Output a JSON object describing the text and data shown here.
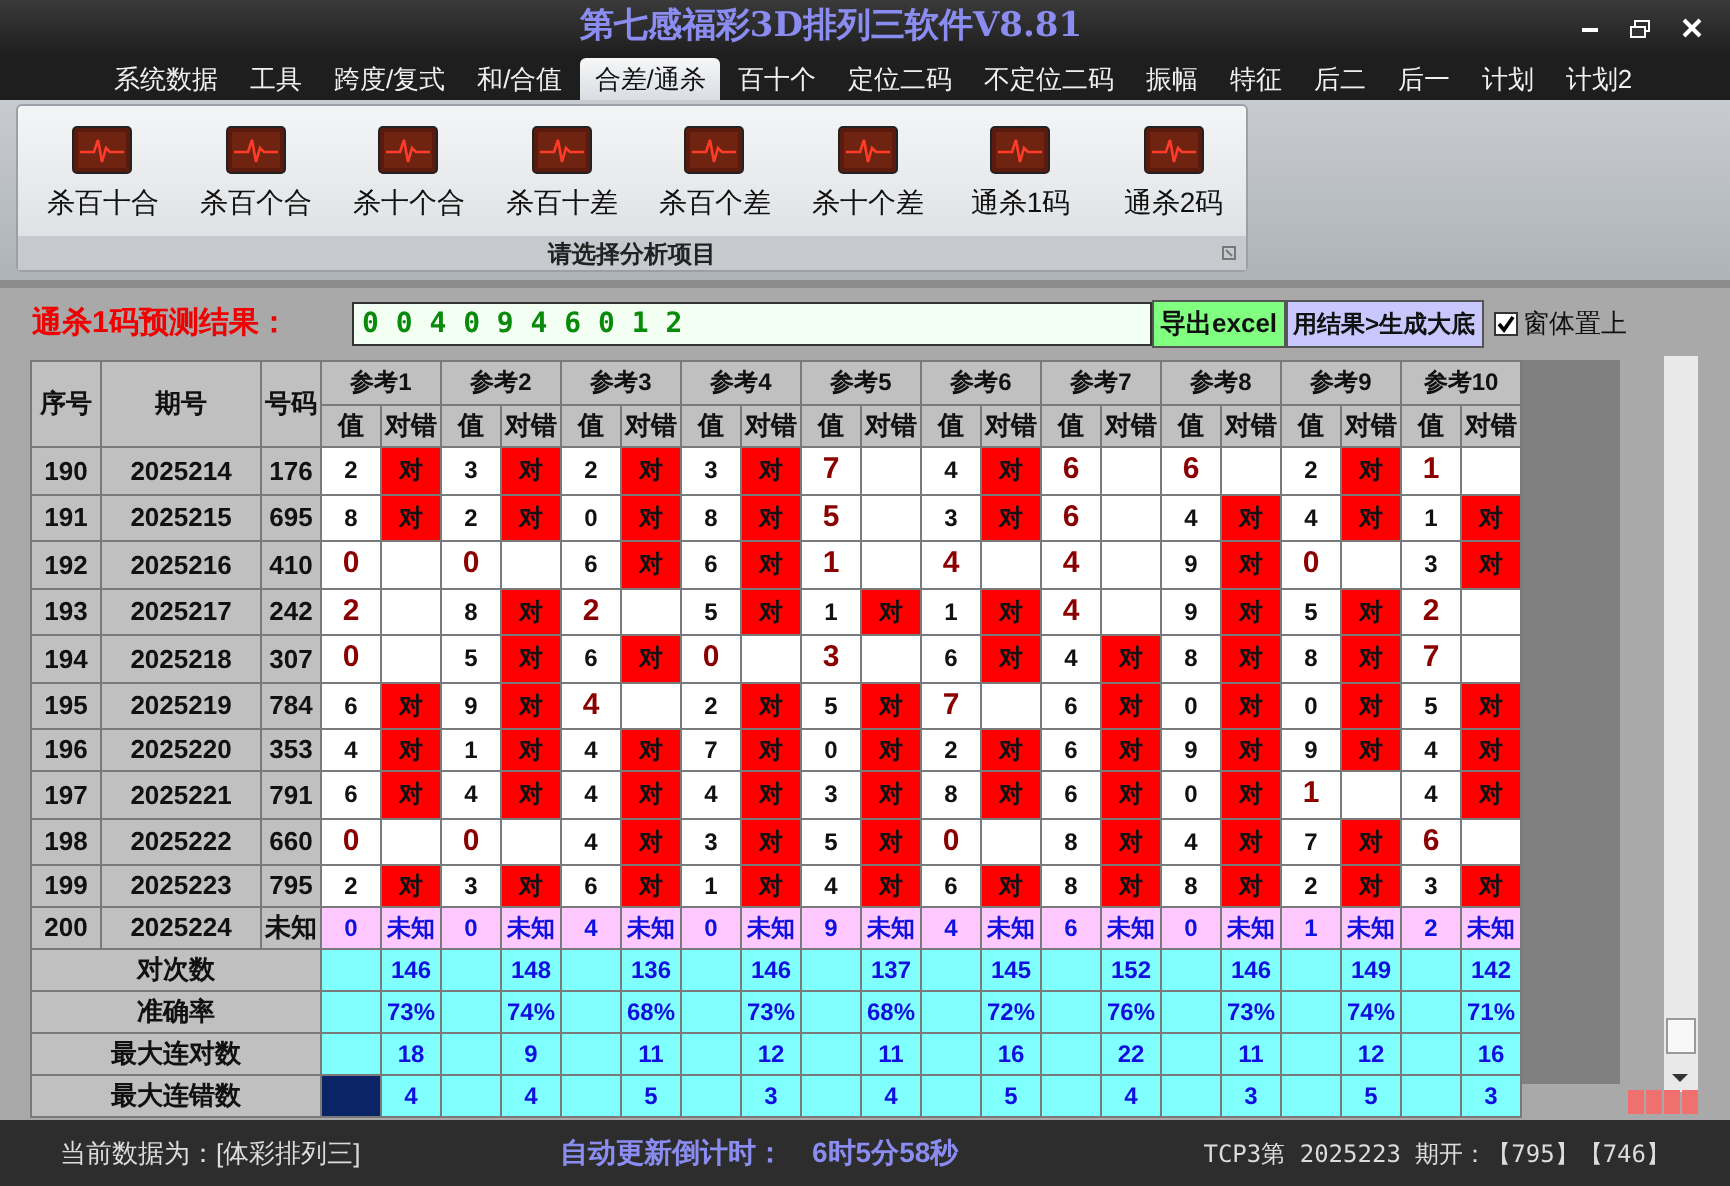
{
  "window": {
    "title": "第七感福彩3D排列三软件V8.81"
  },
  "menu_tabs": [
    {
      "label": "系统数据",
      "selected": false
    },
    {
      "label": "工具",
      "selected": false
    },
    {
      "label": "跨度/复式",
      "selected": false
    },
    {
      "label": "和/合值",
      "selected": false
    },
    {
      "label": "合差/通杀",
      "selected": true
    },
    {
      "label": "百十个",
      "selected": false
    },
    {
      "label": "定位二码",
      "selected": false
    },
    {
      "label": "不定位二码",
      "selected": false
    },
    {
      "label": "振幅",
      "selected": false
    },
    {
      "label": "特征",
      "selected": false
    },
    {
      "label": "后二",
      "selected": false
    },
    {
      "label": "后一",
      "selected": false
    },
    {
      "label": "计划",
      "selected": false
    },
    {
      "label": "计划2",
      "selected": false
    }
  ],
  "ribbon": {
    "items": [
      "杀百十合",
      "杀百个合",
      "杀十个合",
      "杀百十差",
      "杀百个差",
      "杀十个差",
      "通杀1码",
      "通杀2码"
    ],
    "group_label": "请选择分析项目"
  },
  "prediction": {
    "label": "通杀1码预测结果：",
    "value": "0 0 4 0 9 4 6 0 1 2",
    "buttons": [
      "导出excel",
      "用结果>生成大底"
    ],
    "checkbox": {
      "label": "窗体置上",
      "checked": true
    }
  },
  "table": {
    "columns": [
      "序号",
      "期号",
      "号码"
    ],
    "groups": [
      {
        "label": "参考1",
        "sub_columns": [
          "值",
          "对错"
        ]
      },
      {
        "label": "参考2",
        "sub_columns": [
          "值",
          "对错"
        ]
      },
      {
        "label": "参考3",
        "sub_columns": [
          "值",
          "对错"
        ]
      },
      {
        "label": "参考4",
        "sub_columns": [
          "值",
          "对错"
        ]
      },
      {
        "label": "参考5",
        "sub_columns": [
          "值",
          "对错"
        ]
      },
      {
        "label": "参考6",
        "sub_columns": [
          "值",
          "对错"
        ]
      },
      {
        "label": "参考7",
        "sub_columns": [
          "值",
          "对错"
        ]
      },
      {
        "label": "参考8",
        "sub_columns": [
          "值",
          "对错"
        ]
      },
      {
        "label": "参考9",
        "sub_columns": [
          "值",
          "对错"
        ]
      },
      {
        "label": "参考10",
        "sub_columns": [
          "值",
          "对错"
        ]
      }
    ],
    "rows": [
      {
        "kind": "result",
        "seq": "190",
        "issue": "2025214",
        "number": "176",
        "refs": [
          {
            "value": "2",
            "mark": "对"
          },
          {
            "value": "3",
            "mark": "对"
          },
          {
            "value": "2",
            "mark": "对"
          },
          {
            "value": "3",
            "mark": "对"
          },
          {
            "value": "7"
          },
          {
            "value": "4",
            "mark": "对"
          },
          {
            "value": "6"
          },
          {
            "value": "6"
          },
          {
            "value": "2",
            "mark": "对"
          },
          {
            "value": "1"
          }
        ]
      },
      {
        "kind": "result",
        "seq": "191",
        "issue": "2025215",
        "number": "695",
        "refs": [
          {
            "value": "8",
            "mark": "对"
          },
          {
            "value": "2",
            "mark": "对"
          },
          {
            "value": "0",
            "mark": "对"
          },
          {
            "value": "8",
            "mark": "对"
          },
          {
            "value": "5"
          },
          {
            "value": "3",
            "mark": "对"
          },
          {
            "value": "6"
          },
          {
            "value": "4",
            "mark": "对"
          },
          {
            "value": "4",
            "mark": "对"
          },
          {
            "value": "1",
            "mark": "对"
          }
        ]
      },
      {
        "kind": "result",
        "seq": "192",
        "issue": "2025216",
        "number": "410",
        "refs": [
          {
            "value": "0"
          },
          {
            "value": "0"
          },
          {
            "value": "6",
            "mark": "对"
          },
          {
            "value": "6",
            "mark": "对"
          },
          {
            "value": "1"
          },
          {
            "value": "4"
          },
          {
            "value": "4"
          },
          {
            "value": "9",
            "mark": "对"
          },
          {
            "value": "0"
          },
          {
            "value": "3",
            "mark": "对"
          }
        ]
      },
      {
        "kind": "result",
        "seq": "193",
        "issue": "2025217",
        "number": "242",
        "refs": [
          {
            "value": "2"
          },
          {
            "value": "8",
            "mark": "对"
          },
          {
            "value": "2"
          },
          {
            "value": "5",
            "mark": "对"
          },
          {
            "value": "1",
            "mark": "对"
          },
          {
            "value": "1",
            "mark": "对"
          },
          {
            "value": "4"
          },
          {
            "value": "9",
            "mark": "对"
          },
          {
            "value": "5",
            "mark": "对"
          },
          {
            "value": "2"
          }
        ]
      },
      {
        "kind": "result",
        "seq": "194",
        "issue": "2025218",
        "number": "307",
        "refs": [
          {
            "value": "0"
          },
          {
            "value": "5",
            "mark": "对"
          },
          {
            "value": "6",
            "mark": "对"
          },
          {
            "value": "0"
          },
          {
            "value": "3"
          },
          {
            "value": "6",
            "mark": "对"
          },
          {
            "value": "4",
            "mark": "对"
          },
          {
            "value": "8",
            "mark": "对"
          },
          {
            "value": "8",
            "mark": "对"
          },
          {
            "value": "7"
          }
        ]
      },
      {
        "kind": "result",
        "seq": "195",
        "issue": "2025219",
        "number": "784",
        "refs": [
          {
            "value": "6",
            "mark": "对"
          },
          {
            "value": "9",
            "mark": "对"
          },
          {
            "value": "4"
          },
          {
            "value": "2",
            "mark": "对"
          },
          {
            "value": "5",
            "mark": "对"
          },
          {
            "value": "7"
          },
          {
            "value": "6",
            "mark": "对"
          },
          {
            "value": "0",
            "mark": "对"
          },
          {
            "value": "0",
            "mark": "对"
          },
          {
            "value": "5",
            "mark": "对"
          }
        ]
      },
      {
        "kind": "result",
        "seq": "196",
        "issue": "2025220",
        "number": "353",
        "refs": [
          {
            "value": "4",
            "mark": "对"
          },
          {
            "value": "1",
            "mark": "对"
          },
          {
            "value": "4",
            "mark": "对"
          },
          {
            "value": "7",
            "mark": "对"
          },
          {
            "value": "0",
            "mark": "对"
          },
          {
            "value": "2",
            "mark": "对"
          },
          {
            "value": "6",
            "mark": "对"
          },
          {
            "value": "9",
            "mark": "对"
          },
          {
            "value": "9",
            "mark": "对"
          },
          {
            "value": "4",
            "mark": "对"
          }
        ]
      },
      {
        "kind": "result",
        "seq": "197",
        "issue": "2025221",
        "number": "791",
        "refs": [
          {
            "value": "6",
            "mark": "对"
          },
          {
            "value": "4",
            "mark": "对"
          },
          {
            "value": "4",
            "mark": "对"
          },
          {
            "value": "4",
            "mark": "对"
          },
          {
            "value": "3",
            "mark": "对"
          },
          {
            "value": "8",
            "mark": "对"
          },
          {
            "value": "6",
            "mark": "对"
          },
          {
            "value": "0",
            "mark": "对"
          },
          {
            "value": "1"
          },
          {
            "value": "4",
            "mark": "对"
          }
        ]
      },
      {
        "kind": "result",
        "seq": "198",
        "issue": "2025222",
        "number": "660",
        "refs": [
          {
            "value": "0"
          },
          {
            "value": "0"
          },
          {
            "value": "4",
            "mark": "对"
          },
          {
            "value": "3",
            "mark": "对"
          },
          {
            "value": "5",
            "mark": "对"
          },
          {
            "value": "0"
          },
          {
            "value": "8",
            "mark": "对"
          },
          {
            "value": "4",
            "mark": "对"
          },
          {
            "value": "7",
            "mark": "对"
          },
          {
            "value": "6"
          }
        ]
      },
      {
        "kind": "result",
        "seq": "199",
        "issue": "2025223",
        "number": "795",
        "refs": [
          {
            "value": "2",
            "mark": "对"
          },
          {
            "value": "3",
            "mark": "对"
          },
          {
            "value": "6",
            "mark": "对"
          },
          {
            "value": "1",
            "mark": "对"
          },
          {
            "value": "4",
            "mark": "对"
          },
          {
            "value": "6",
            "mark": "对"
          },
          {
            "value": "8",
            "mark": "对"
          },
          {
            "value": "8",
            "mark": "对"
          },
          {
            "value": "2",
            "mark": "对"
          },
          {
            "value": "3",
            "mark": "对"
          }
        ]
      },
      {
        "kind": "pending",
        "seq": "200",
        "issue": "2025224",
        "number": "未知",
        "refs": [
          {
            "value": "0",
            "mark": "未知"
          },
          {
            "value": "0",
            "mark": "未知"
          },
          {
            "value": "4",
            "mark": "未知"
          },
          {
            "value": "0",
            "mark": "未知"
          },
          {
            "value": "9",
            "mark": "未知"
          },
          {
            "value": "4",
            "mark": "未知"
          },
          {
            "value": "6",
            "mark": "未知"
          },
          {
            "value": "0",
            "mark": "未知"
          },
          {
            "value": "1",
            "mark": "未知"
          },
          {
            "value": "2",
            "mark": "未知"
          }
        ]
      }
    ],
    "summary": [
      {
        "label": "对次数",
        "focused": false,
        "values": [
          "146",
          "148",
          "136",
          "146",
          "137",
          "145",
          "152",
          "146",
          "149",
          "142"
        ]
      },
      {
        "label": "准确率",
        "focused": false,
        "values": [
          "73%",
          "74%",
          "68%",
          "73%",
          "68%",
          "72%",
          "76%",
          "73%",
          "74%",
          "71%"
        ]
      },
      {
        "label": "最大连对数",
        "focused": false,
        "values": [
          "18",
          "9",
          "11",
          "12",
          "11",
          "16",
          "22",
          "11",
          "12",
          "16"
        ]
      },
      {
        "label": "最大连错数",
        "focused": true,
        "values": [
          "4",
          "4",
          "5",
          "3",
          "4",
          "5",
          "4",
          "3",
          "5",
          "3"
        ]
      }
    ]
  },
  "status_bar": {
    "data_source": "当前数据为：[体彩排列三]",
    "countdown_label": "自动更新倒计时：",
    "countdown": "6时5分58秒",
    "last_draw": "TCP3第 2025223 期开：【795】【746】"
  }
}
